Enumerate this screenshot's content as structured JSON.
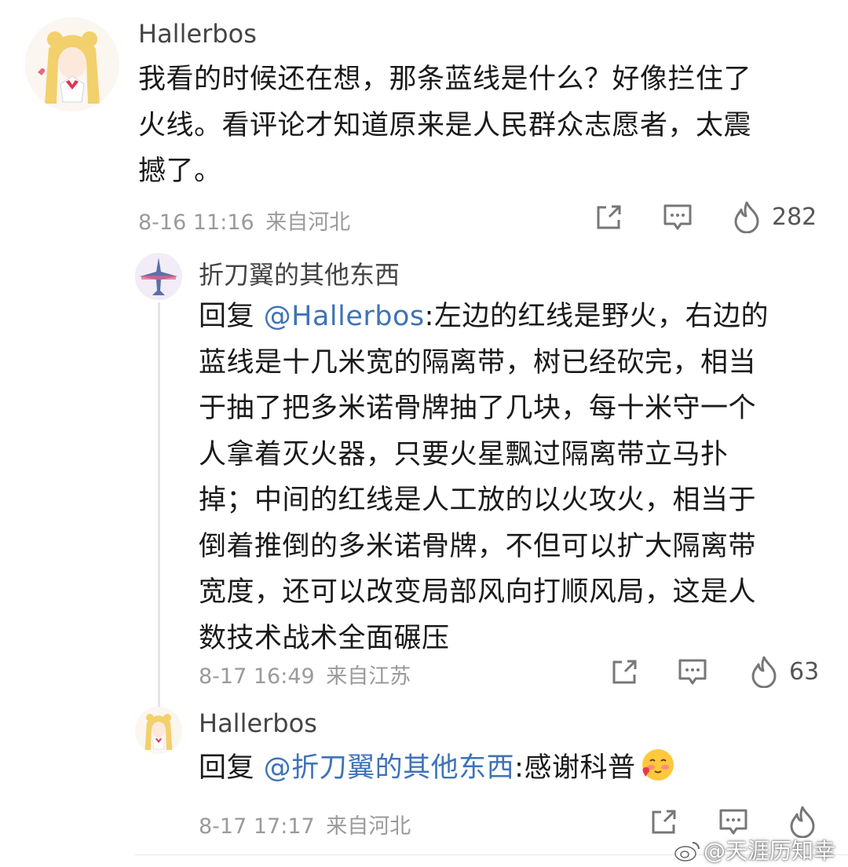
{
  "comment": {
    "username": "Hallerbos",
    "lines": [
      "我看的时候还在想，那条蓝线是什么？好像拦住了",
      "火线。看评论才知道原来是人民群众志愿者，太震",
      "撼了。"
    ],
    "time": "8-16 11:16",
    "location": "来自河北",
    "like_count": "282"
  },
  "reply1": {
    "username": "折刀翼的其他东西",
    "reply_prefix": "回复 ",
    "mention": "@Hallerbos",
    "first_line_rest": ":左边的红线是野火，右边的",
    "lines": [
      "蓝线是十几米宽的隔离带，树已经砍完，相当",
      "于抽了把多米诺骨牌抽了几块，每十米守一个",
      "人拿着灭火器，只要火星飘过隔离带立马扑",
      "掉；中间的红线是人工放的以火攻火，相当于",
      "倒着推倒的多米诺骨牌，不但可以扩大隔离带",
      "宽度，还可以改变局部风向打顺风局，这是人",
      "数技术战术全面碾压"
    ],
    "time": "8-17 16:49",
    "location": "来自江苏",
    "like_count": "63"
  },
  "reply2": {
    "username": "Hallerbos",
    "reply_prefix": "回复 ",
    "mention": "@折刀翼的其他东西",
    "rest": ":感谢科普",
    "time": "8-17 17:17",
    "location": "来自河北"
  },
  "watermark": "@天涯历知幸",
  "icons": {
    "share": "share-icon",
    "comment": "comment-icon",
    "like": "flame-like-icon",
    "emoji": "blush-heart-emoji-icon"
  },
  "colors": {
    "mention": "#3f73b7",
    "meta": "#9a9a9a",
    "text": "#1a1a1a"
  }
}
